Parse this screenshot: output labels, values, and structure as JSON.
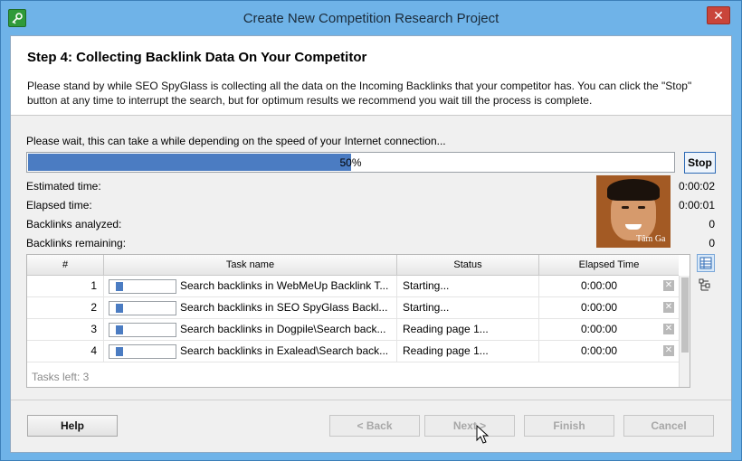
{
  "window": {
    "title": "Create New Competition Research Project",
    "close_glyph": "✕",
    "app_icon": "key-icon"
  },
  "header": {
    "step_title": "Step 4: Collecting Backlink Data On Your Competitor",
    "description": "Please stand by while SEO SpyGlass is collecting all the data on the Incoming Backlinks that your competitor has. You can click the \"Stop\" button at any time to interrupt the search, but for optimum results we recommend you wait till the process is complete."
  },
  "progress": {
    "wait_text": "Please wait, this can take a while depending on the speed of your Internet connection...",
    "percent_label": "50%",
    "percent": 50,
    "stop_label": "Stop",
    "fill_color": "#4b7cc2"
  },
  "stats": [
    {
      "label": "Estimated time:",
      "value": "0:00:02"
    },
    {
      "label": "Elapsed time:",
      "value": "0:00:01"
    },
    {
      "label": "Backlinks analyzed:",
      "value": "0"
    },
    {
      "label": "Backlinks remaining:",
      "value": "0"
    }
  ],
  "photo": {
    "caption": "Tâm Ga"
  },
  "table": {
    "columns": [
      "#",
      "Task name",
      "Status",
      "Elapsed Time"
    ],
    "rows": [
      {
        "num": "1",
        "task": "Search backlinks in WebMeUp Backlink T...",
        "status": "Starting...",
        "elapsed": "0:00:00",
        "progress": 0.12
      },
      {
        "num": "2",
        "task": "Search backlinks in SEO SpyGlass Backl...",
        "status": "Starting...",
        "elapsed": "0:00:00",
        "progress": 0.12
      },
      {
        "num": "3",
        "task": "Search backlinks in Dogpile\\Search back...",
        "status": "Reading page 1...",
        "elapsed": "0:00:00",
        "progress": 0.12
      },
      {
        "num": "4",
        "task": "Search backlinks in Exalead\\Search back...",
        "status": "Reading page 1...",
        "elapsed": "0:00:00",
        "progress": 0.12
      }
    ],
    "tasks_left": "Tasks left: 3",
    "row_close_glyph": "✕"
  },
  "side_icons": [
    "table-view-icon",
    "tree-view-icon"
  ],
  "buttons": {
    "help": "Help",
    "back": "< Back",
    "next": "Next >",
    "finish": "Finish",
    "cancel": "Cancel"
  }
}
